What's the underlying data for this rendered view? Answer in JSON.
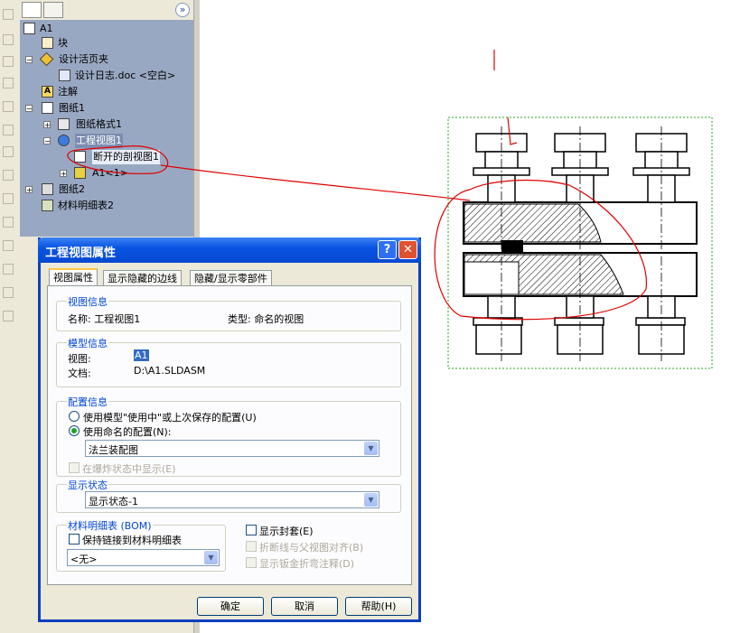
{
  "tree": {
    "items": [
      {
        "label": "A1",
        "icon": "drawing-icon",
        "expander": ""
      },
      {
        "label": "块",
        "icon": "block-icon",
        "expander": ""
      },
      {
        "label": "设计活页夹",
        "icon": "folder-icon",
        "expander": "−"
      },
      {
        "label": "设计日志.doc <空白>",
        "icon": "document-icon",
        "expander": ""
      },
      {
        "label": "注解",
        "icon": "annotation-icon",
        "expander": ""
      },
      {
        "label": "图纸1",
        "icon": "sheet-icon",
        "expander": "−"
      },
      {
        "label": "图纸格式1",
        "icon": "sheet-format-icon",
        "expander": "+"
      },
      {
        "label": "工程视图1",
        "icon": "drawing-view-icon",
        "expander": "−"
      },
      {
        "label": "断开的剖视图1",
        "icon": "broken-section-icon",
        "expander": ""
      },
      {
        "label": "A1<1>",
        "icon": "assembly-icon",
        "expander": "+"
      },
      {
        "label": "图纸2",
        "icon": "sheet-icon",
        "expander": "+"
      },
      {
        "label": "材料明细表2",
        "icon": "bom-icon",
        "expander": ""
      }
    ]
  },
  "dialog": {
    "title": "工程视图属性",
    "help_btn": "?",
    "close_btn": "✕",
    "tabs": [
      "视图属性",
      "显示隐藏的边线",
      "隐藏/显示零部件"
    ],
    "view_info": {
      "group_label": "视图信息",
      "name": "名称: 工程视图1",
      "type": "类型: 命名的视图"
    },
    "model_info": {
      "group_label": "模型信息",
      "view_label": "视图:",
      "view_value": "A1",
      "doc_label": "文档:",
      "doc_value": "D:\\A1.SLDASM"
    },
    "config_info": {
      "group_label": "配置信息",
      "radio1": "使用模型\"使用中\"或上次保存的配置(U)",
      "radio2": "使用命名的配置(N):",
      "config_value": "法兰装配图",
      "exploded_chk": "在爆炸状态中显示(E)"
    },
    "display_state": {
      "group_label": "显示状态",
      "value": "显示状态-1"
    },
    "bom": {
      "group_label": "材料明细表 (BOM)",
      "link_chk": "保持链接到材料明细表",
      "value": "<无>"
    },
    "options": {
      "envelope_chk": "显示封套(E)",
      "align_chk": "折断线与父视图对齐(B)",
      "sheetmetal_chk": "显示钣金折弯注释(D)"
    },
    "buttons": {
      "ok": "确定",
      "cancel": "取消",
      "help": "帮助(H)"
    }
  },
  "colors": {
    "title_bar": "#0a54e3",
    "tree_bg": "#99a8c2",
    "annotation_red": "#e00000",
    "drawing_frame": "#22aa22"
  }
}
